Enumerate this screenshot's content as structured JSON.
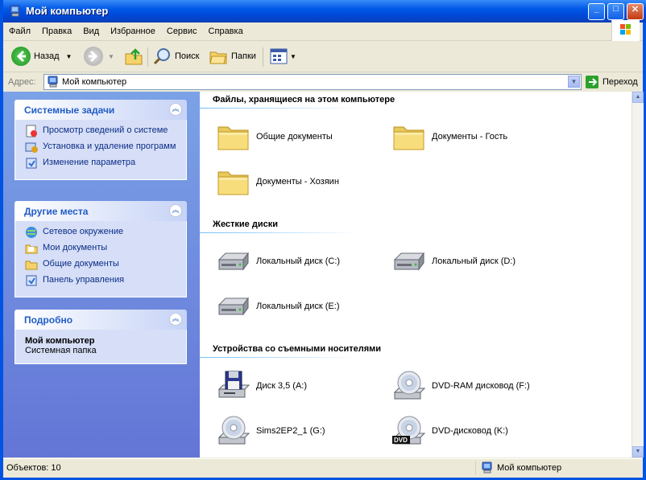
{
  "window": {
    "title": "Мой компьютер"
  },
  "menu": [
    "Файл",
    "Правка",
    "Вид",
    "Избранное",
    "Сервис",
    "Справка"
  ],
  "toolbar": {
    "back": "Назад",
    "search": "Поиск",
    "folders": "Папки"
  },
  "address": {
    "label": "Адрес:",
    "value": "Мой компьютер",
    "go": "Переход"
  },
  "tasks": {
    "system": {
      "title": "Системные задачи",
      "items": [
        "Просмотр сведений о системе",
        "Установка и удаление программ",
        "Изменение параметра"
      ]
    },
    "places": {
      "title": "Другие места",
      "items": [
        "Сетевое окружение",
        "Мои документы",
        "Общие документы",
        "Панель управления"
      ]
    },
    "details": {
      "title": "Подробно",
      "name": "Мой компьютер",
      "type": "Системная папка"
    }
  },
  "groups": {
    "files": {
      "title": "Файлы, хранящиеся на этом компьютере",
      "items": [
        "Общие документы",
        "Документы - Гость",
        "Документы - Хозяин"
      ]
    },
    "drives": {
      "title": "Жесткие диски",
      "items": [
        "Локальный диск (C:)",
        "Локальный диск (D:)",
        "Локальный диск (E:)"
      ]
    },
    "removable": {
      "title": "Устройства со съемными носителями",
      "items": [
        "Диск 3,5 (A:)",
        "DVD-RAM дисковод (F:)",
        "Sims2EP2_1 (G:)",
        "DVD-дисковод (K:)"
      ]
    }
  },
  "status": {
    "count": "Объектов: 10",
    "location": "Мой компьютер"
  }
}
